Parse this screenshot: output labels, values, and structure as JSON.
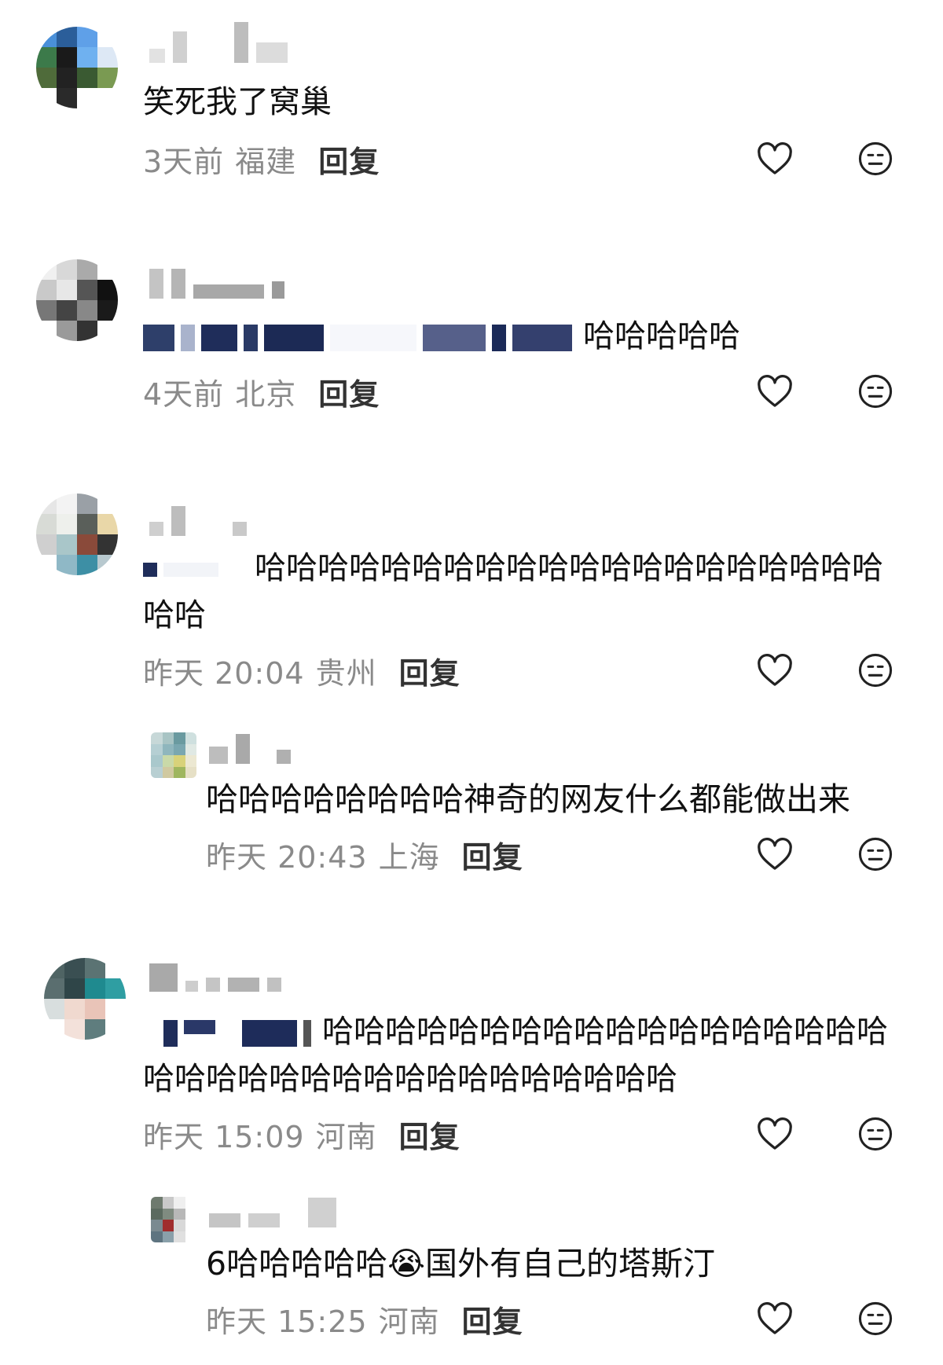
{
  "comments": [
    {
      "text": "笑死我了窝巢",
      "time": "3天前",
      "region": "福建",
      "reply_label": "回复"
    },
    {
      "text": "哈哈哈哈哈",
      "time": "4天前",
      "region": "北京",
      "reply_label": "回复"
    },
    {
      "text": "哈哈哈哈哈哈哈哈哈哈哈哈哈哈哈哈哈哈哈哈哈哈",
      "time": "昨天 20:04",
      "region": "贵州",
      "reply_label": "回复",
      "reply": {
        "text": "哈哈哈哈哈哈哈哈神奇的网友什么都能做出来",
        "time": "昨天 20:43",
        "region": "上海",
        "reply_label": "回复"
      }
    },
    {
      "text": "哈哈哈哈哈哈哈哈哈哈哈哈哈哈哈哈哈哈哈哈哈哈哈哈哈哈哈哈哈哈哈哈哈哈哈",
      "time": "昨天 15:09",
      "region": "河南",
      "reply_label": "回复",
      "reply": {
        "text_before": "6哈哈哈哈哈",
        "emoji": "😭",
        "text_after": "国外有自己的塔斯汀",
        "time": "昨天 15:25",
        "region": "河南",
        "reply_label": "回复"
      }
    }
  ],
  "icons": {
    "like": "heart-outline-icon",
    "dislike": "neutral-face-icon"
  },
  "colors": {
    "text": "#111111",
    "meta": "#8a8a8a",
    "reply_button": "#333333",
    "background": "#ffffff"
  }
}
